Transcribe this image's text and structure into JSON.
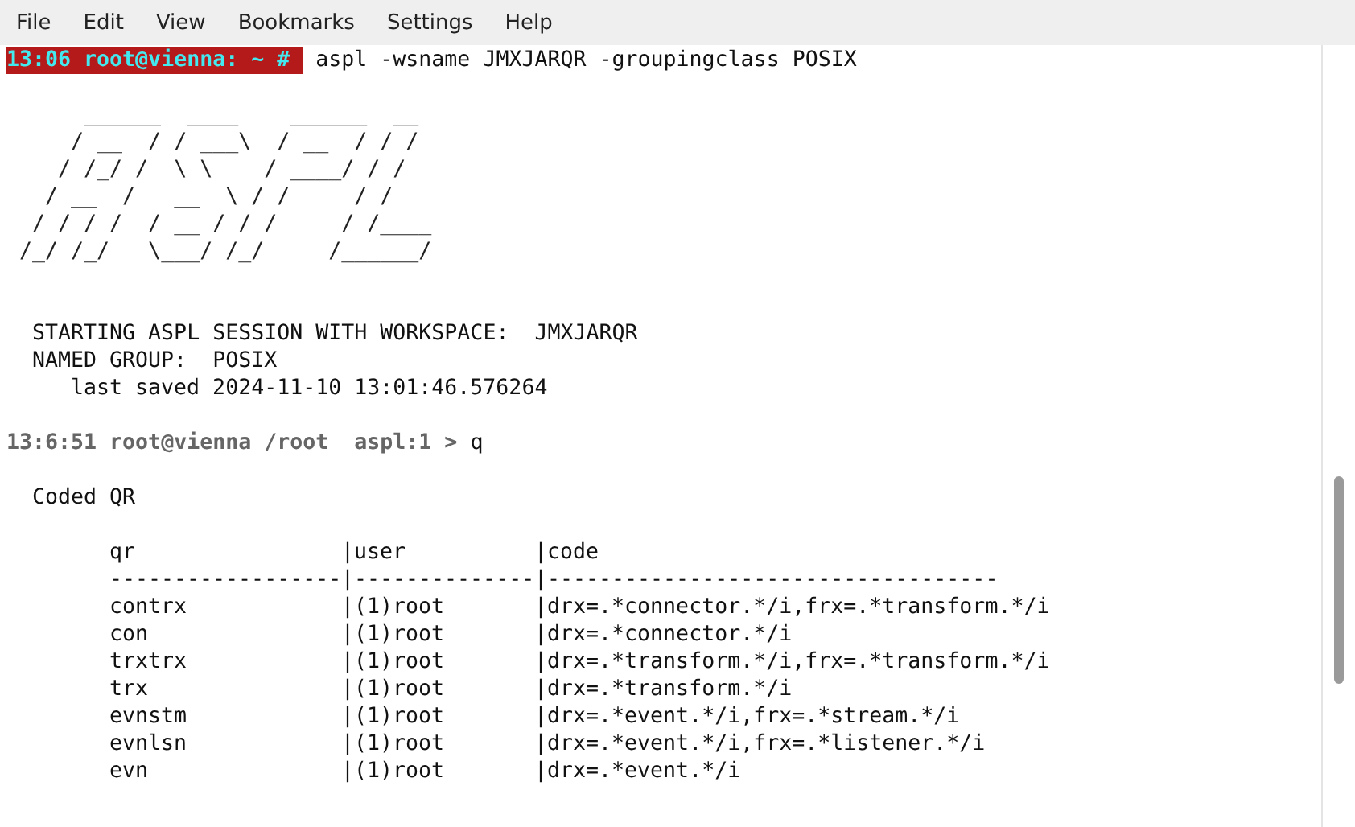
{
  "menu": [
    "File",
    "Edit",
    "View",
    "Bookmarks",
    "Settings",
    "Help"
  ],
  "prompt": {
    "text": "13:06 root@vienna: ~ #",
    "command": "aspl -wsname JMXJARQR -groupingclass POSIX"
  },
  "banner": [
    "      ______  ____    ______  __",
    "     / __  / / ___\\  / __  / / /",
    "    / /_/ /  \\ \\    / ____/ / /",
    "   / __  /   __  \\ / /     / /",
    "  / / / /  / __ / / /     / /____",
    " /_/ /_/   \\___/ /_/     /______/"
  ],
  "session": {
    "workspace_line": "STARTING ASPL SESSION WITH WORKSPACE:  JMXJARQR",
    "group_line": "NAMED GROUP:  POSIX",
    "saved_line": "last saved 2024-11-10 13:01:46.576264"
  },
  "prompt2": {
    "text": "13:6:51 root@vienna /root  aspl:1 >",
    "input": "q"
  },
  "result": {
    "title": "Coded QR",
    "header": [
      "qr",
      "|user",
      "|code"
    ],
    "divider": [
      "------------------",
      "|--------------",
      "|-----------------------------------"
    ],
    "rows": [
      [
        "contrx",
        "|(1)root",
        "|drx=.*connector.*/i,frx=.*transform.*/i"
      ],
      [
        "con",
        "|(1)root",
        "|drx=.*connector.*/i"
      ],
      [
        "trxtrx",
        "|(1)root",
        "|drx=.*transform.*/i,frx=.*transform.*/i"
      ],
      [
        "trx",
        "|(1)root",
        "|drx=.*transform.*/i"
      ],
      [
        "evnstm",
        "|(1)root",
        "|drx=.*event.*/i,frx=.*stream.*/i"
      ],
      [
        "evnlsn",
        "|(1)root",
        "|drx=.*event.*/i,frx=.*listener.*/i"
      ],
      [
        "evn",
        "|(1)root",
        "|drx=.*event.*/i"
      ]
    ]
  }
}
